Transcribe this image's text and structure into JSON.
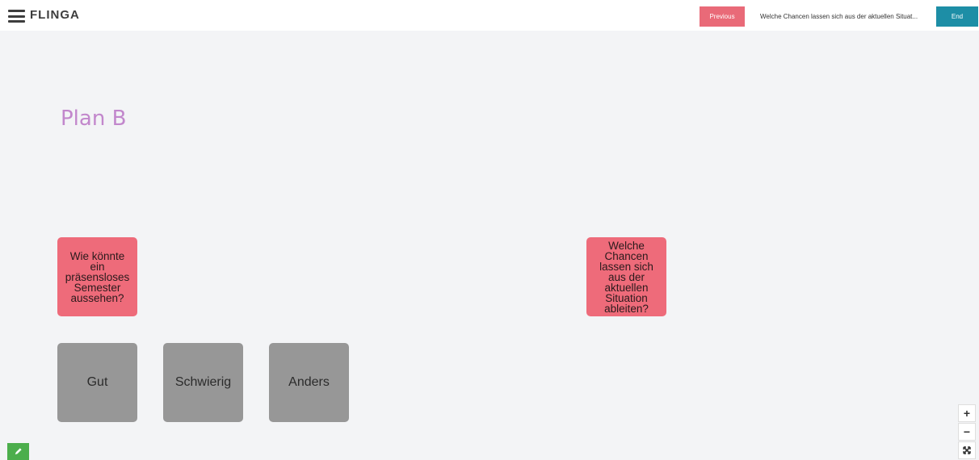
{
  "header": {
    "logo_text": "FLINGA",
    "previous_label": "Previous",
    "current_question": "Welche Chancen lassen sich aus der aktuellen Situat...",
    "end_label": "End"
  },
  "board": {
    "title": "Plan B",
    "cards": [
      {
        "text": "Wie könnte ein präsensloses Semester aussehen?",
        "color": "#ee6b7a"
      },
      {
        "text": "Welche Chancen lassen sich aus der aktuellen Situation ableiten?",
        "color": "#ee6b7a"
      },
      {
        "text": "Gut",
        "color": "#979797"
      },
      {
        "text": "Schwierig",
        "color": "#979797"
      },
      {
        "text": "Anders",
        "color": "#979797"
      }
    ]
  },
  "zoom_controls": {
    "zoom_in_icon": "+",
    "zoom_out_icon": "−",
    "fit_icon": "⤧"
  },
  "colors": {
    "accent_red": "#e96a78",
    "accent_blue": "#1d8ea6",
    "title_purple": "#c287cc",
    "edit_green": "#4cae4c"
  }
}
